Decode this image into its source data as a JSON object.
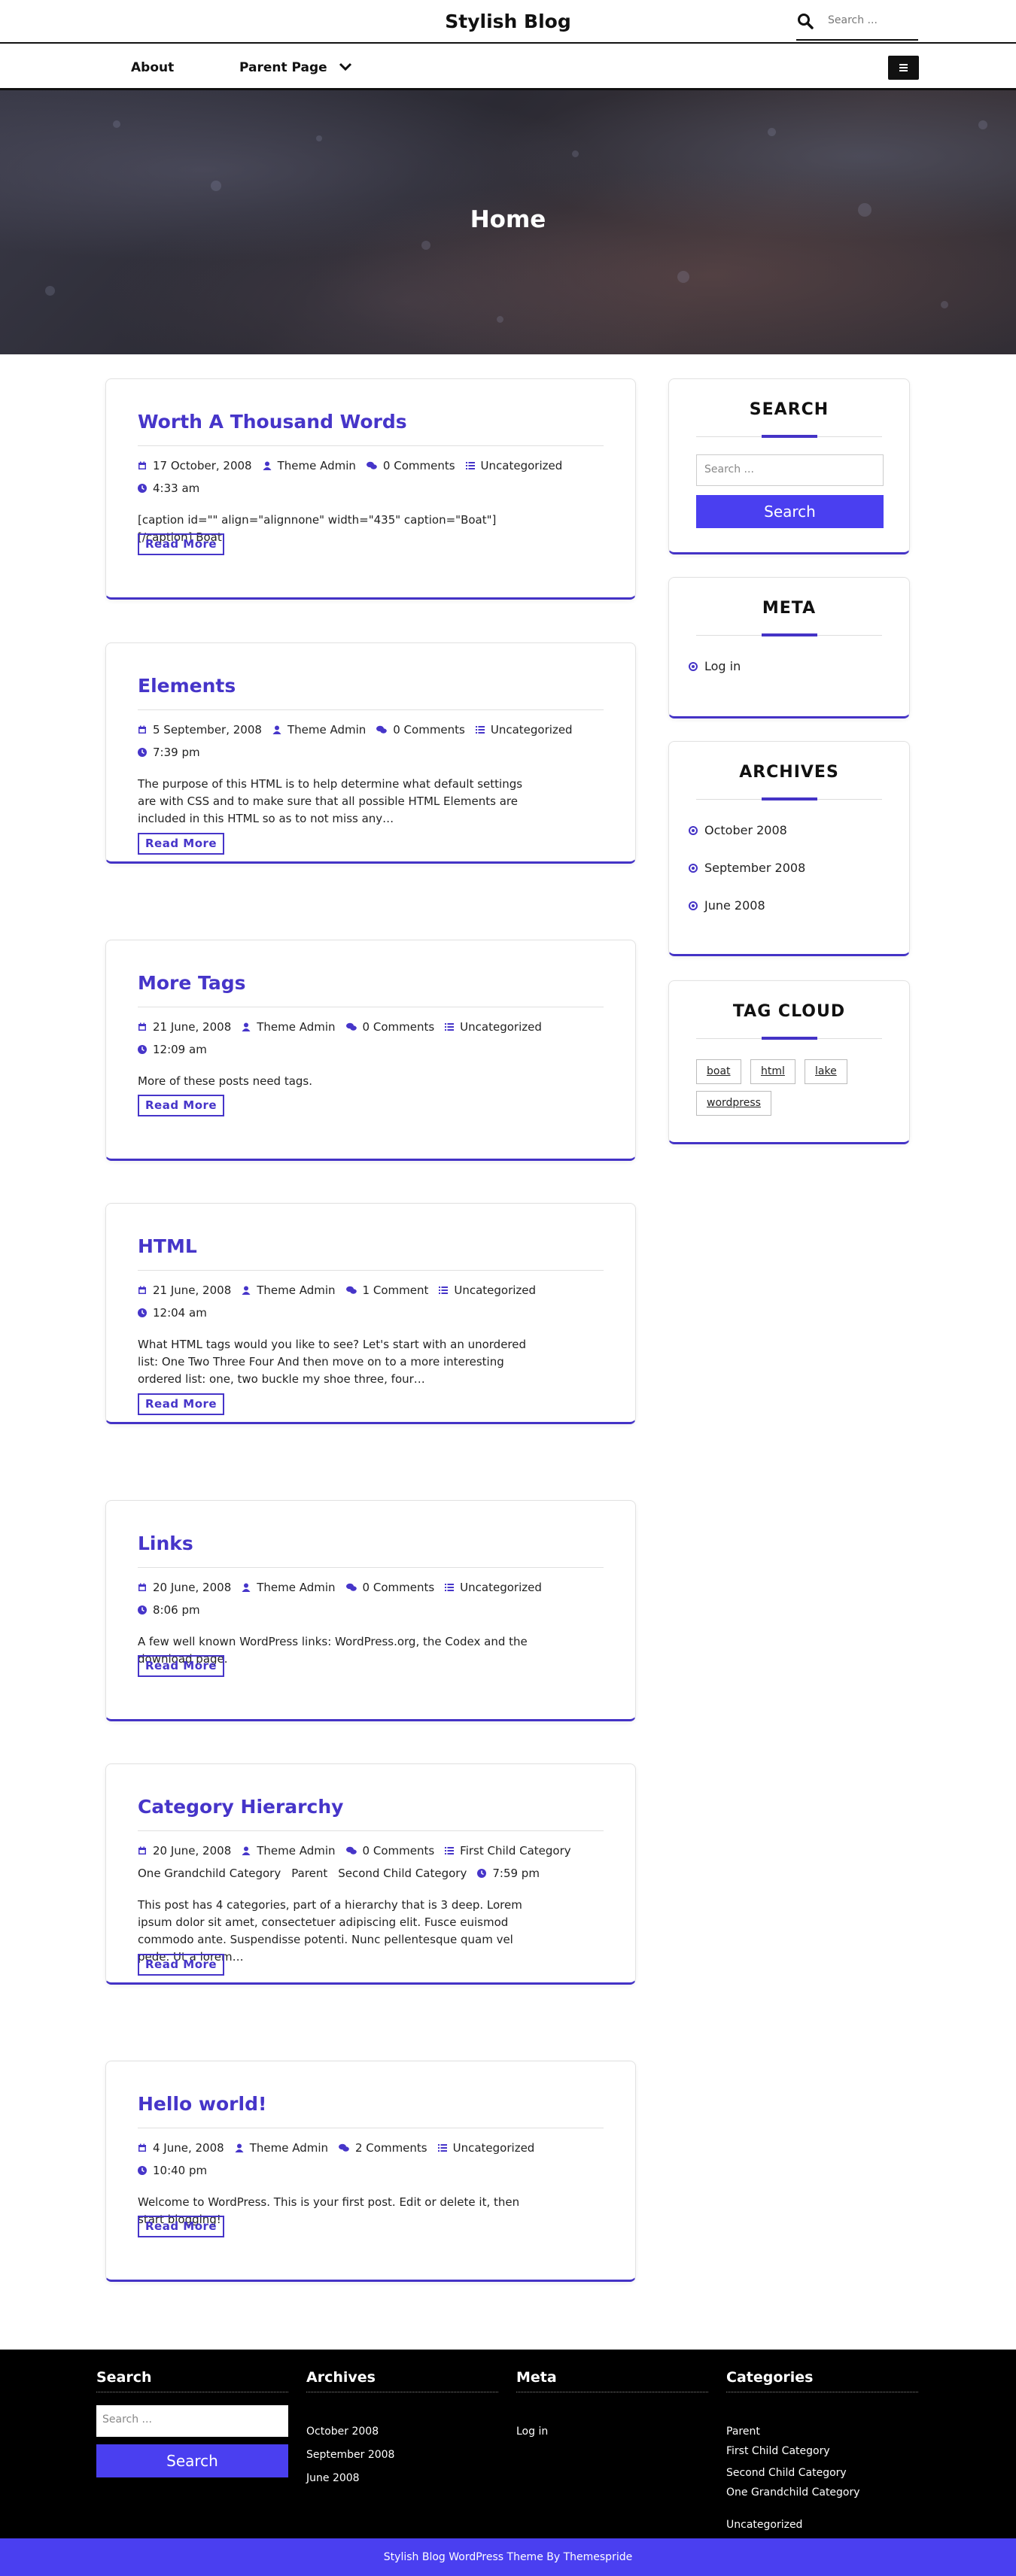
{
  "header": {
    "site_title": "Stylish Blog",
    "search_placeholder": "Search ..."
  },
  "nav": {
    "items": [
      "About",
      "Parent Page"
    ]
  },
  "hero": {
    "title": "Home"
  },
  "posts": [
    {
      "title": "Worth A Thousand Words",
      "date": "17 October, 2008",
      "author": "Theme Admin",
      "comments": "0 Comments",
      "categories": [
        "Uncategorized"
      ],
      "time": "4:33 am",
      "excerpt": "[caption id=\"\" align=\"alignnone\" width=\"435\" caption=\"Boat\"][/caption] Boat.",
      "read_more": "Read More"
    },
    {
      "title": "Elements",
      "date": "5 September, 2008",
      "author": "Theme Admin",
      "comments": "0 Comments",
      "categories": [
        "Uncategorized"
      ],
      "time": "7:39 pm",
      "excerpt": "The purpose of this HTML is to help determine what default settings are with CSS and to make sure that all possible HTML Elements are included in this HTML so as to not miss any…",
      "read_more": "Read More"
    },
    {
      "title": "More Tags",
      "date": "21 June, 2008",
      "author": "Theme Admin",
      "comments": "0 Comments",
      "categories": [
        "Uncategorized"
      ],
      "time": "12:09 am",
      "excerpt": "More of these posts need tags.",
      "read_more": "Read More"
    },
    {
      "title": "HTML",
      "date": "21 June, 2008",
      "author": "Theme Admin",
      "comments": "1 Comment",
      "categories": [
        "Uncategorized"
      ],
      "time": "12:04 am",
      "excerpt": "What HTML tags would you like to see? Let's start with an unordered list: One Two Three Four And then move on to a more interesting ordered list: one, two buckle my shoe three, four…",
      "read_more": "Read More"
    },
    {
      "title": "Links",
      "date": "20 June, 2008",
      "author": "Theme Admin",
      "comments": "0 Comments",
      "categories": [
        "Uncategorized"
      ],
      "time": "8:06 pm",
      "excerpt": "A few well known WordPress links: WordPress.org, the Codex and the download page.",
      "read_more": "Read More"
    },
    {
      "title": "Category Hierarchy",
      "date": "20 June, 2008",
      "author": "Theme Admin",
      "comments": "0 Comments",
      "categories": [
        "First Child Category",
        "One Grandchild Category",
        "Parent",
        "Second Child Category"
      ],
      "time": "7:59 pm",
      "excerpt": "This post has 4 categories, part of a hierarchy that is 3 deep. Lorem ipsum dolor sit amet, consectetuer adipiscing elit. Fusce euismod commodo ante. Suspendisse potenti. Nunc pellentesque quam vel pede. Ut a lorem…",
      "read_more": "Read More"
    },
    {
      "title": "Hello world!",
      "date": "4 June, 2008",
      "author": "Theme Admin",
      "comments": "2 Comments",
      "categories": [
        "Uncategorized"
      ],
      "time": "10:40 pm",
      "excerpt": "Welcome to WordPress. This is your first post. Edit or delete it, then start blogging!",
      "read_more": "Read More"
    }
  ],
  "sidebar": {
    "search": {
      "title": "SEARCH",
      "placeholder": "Search ...",
      "button": "Search"
    },
    "meta": {
      "title": "META",
      "items": [
        "Log in"
      ]
    },
    "archives": {
      "title": "ARCHIVES",
      "items": [
        "October 2008",
        "September 2008",
        "June 2008"
      ]
    },
    "tag_cloud": {
      "title": "TAG CLOUD",
      "tags": [
        "boat",
        "html",
        "lake",
        "wordpress"
      ]
    }
  },
  "footer": {
    "search": {
      "title": "Search",
      "placeholder": "Search ...",
      "button": "Search"
    },
    "archives": {
      "title": "Archives",
      "items": [
        "October 2008",
        "September 2008",
        "June 2008"
      ]
    },
    "meta": {
      "title": "Meta",
      "items": [
        "Log in"
      ]
    },
    "categories": {
      "title": "Categories",
      "items": [
        "Parent",
        "First Child Category",
        "Second Child Category",
        "One Grandchild Category",
        "Uncategorized"
      ]
    },
    "credit": "Stylish Blog WordPress Theme By Themespride"
  },
  "colors": {
    "accent": "#4635c9",
    "button": "#4a3ff0",
    "footer_bg": "#000000"
  }
}
